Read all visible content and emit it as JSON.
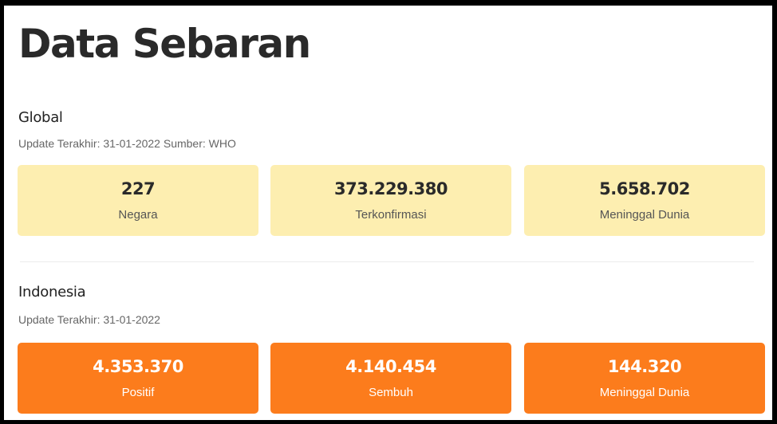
{
  "page": {
    "title": "Data Sebaran"
  },
  "global": {
    "title": "Global",
    "update": "Update Terakhir: 31-01-2022 Sumber: WHO",
    "cards": [
      {
        "value": "227",
        "label": "Negara"
      },
      {
        "value": "373.229.380",
        "label": "Terkonfirmasi"
      },
      {
        "value": "5.658.702",
        "label": "Meninggal Dunia"
      }
    ]
  },
  "indonesia": {
    "title": "Indonesia",
    "update": "Update Terakhir: 31-01-2022",
    "cards": [
      {
        "value": "4.353.370",
        "label": "Positif"
      },
      {
        "value": "4.140.454",
        "label": "Sembuh"
      },
      {
        "value": "144.320",
        "label": "Meninggal Dunia"
      }
    ]
  },
  "colors": {
    "global_card_bg": "#fdeeb0",
    "indonesia_card_bg": "#fc7c1c",
    "frame_border": "#000000"
  }
}
